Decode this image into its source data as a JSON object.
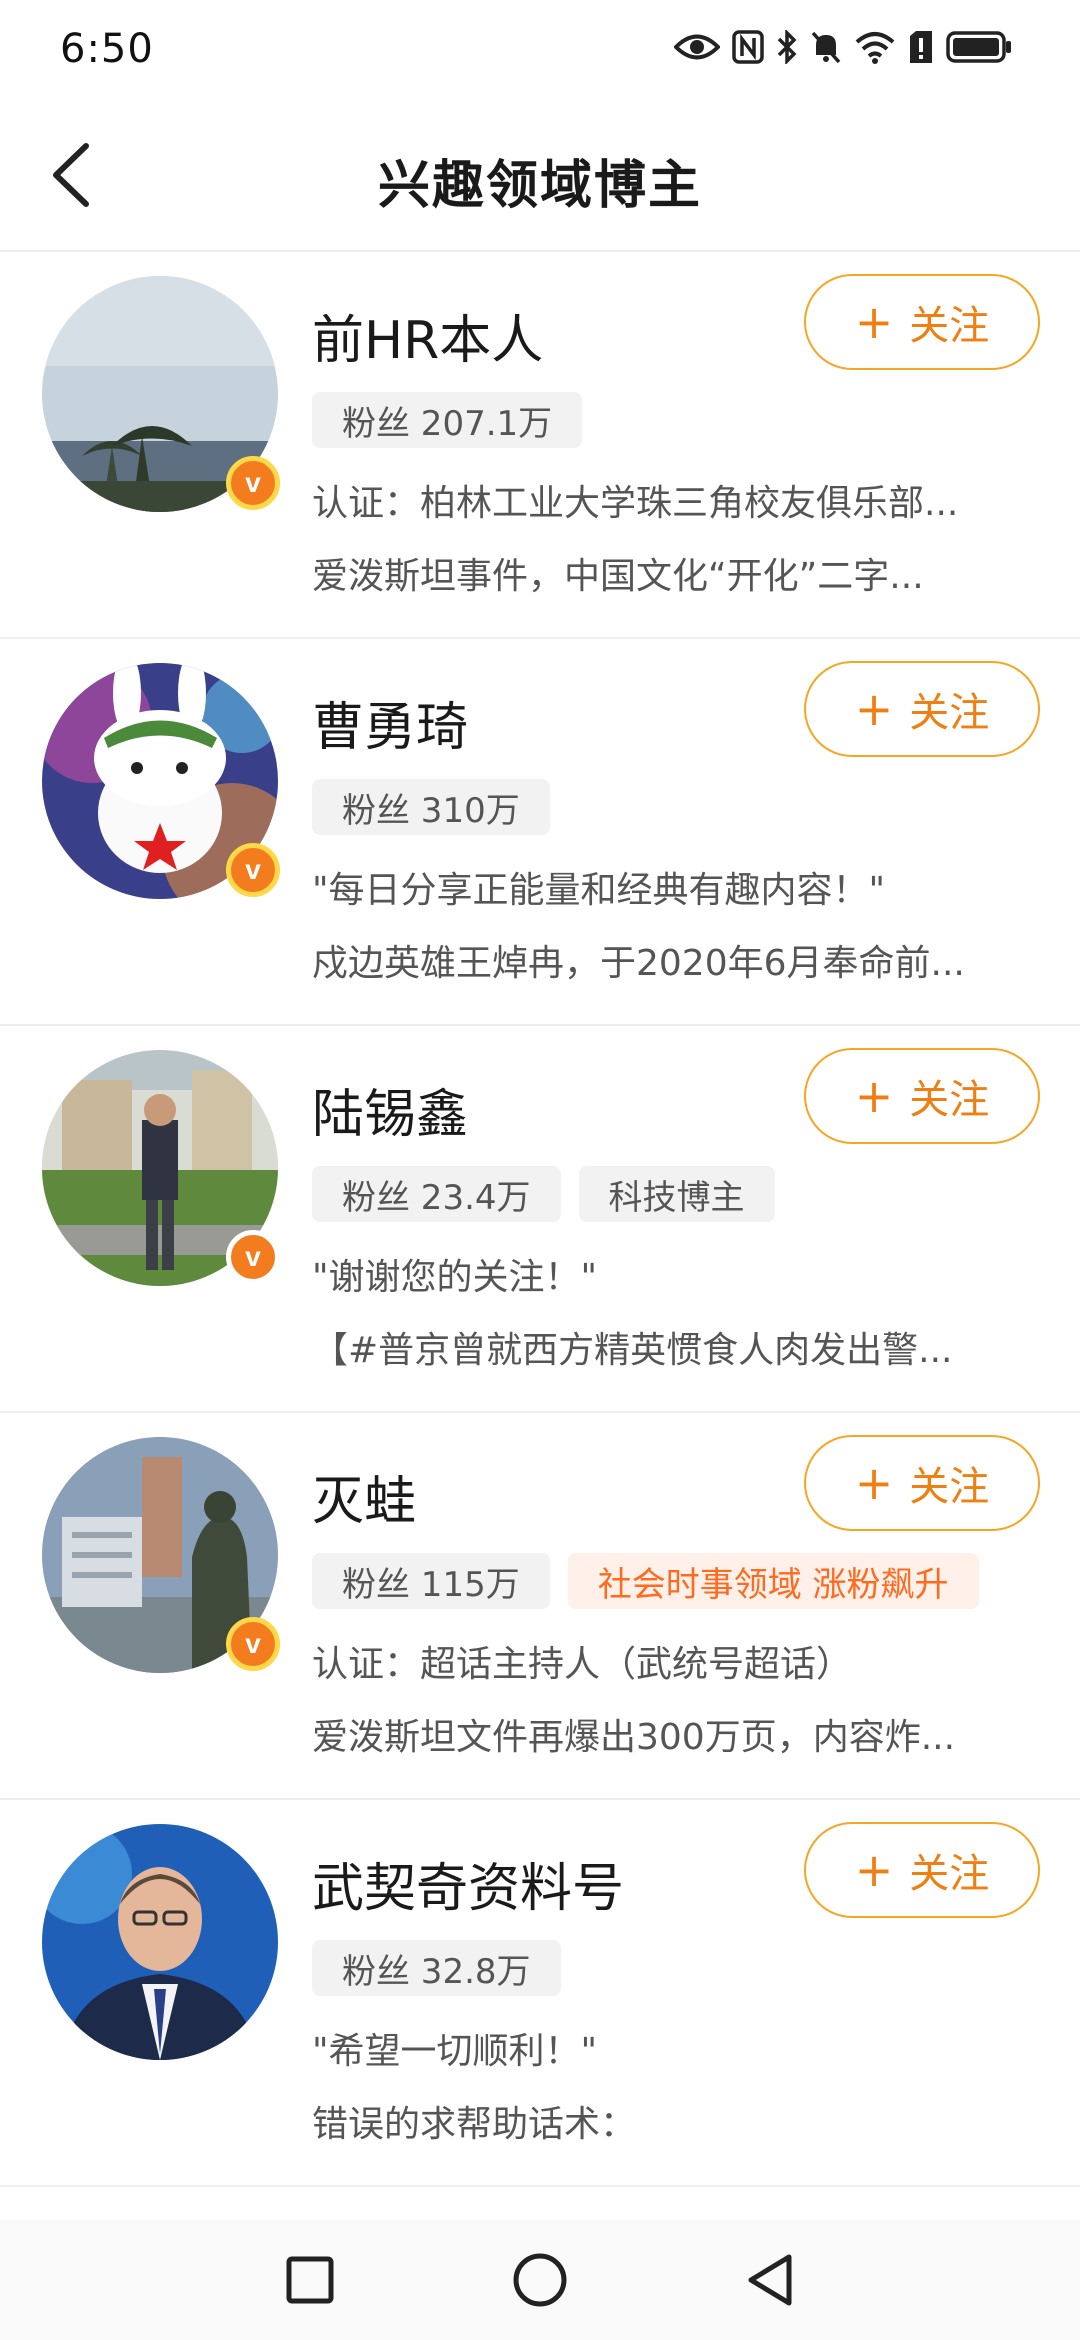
{
  "status_bar": {
    "time": "6:50"
  },
  "header": {
    "title": "兴趣领域博主"
  },
  "follow_label": "关注",
  "follow_plus": "+",
  "verified_mark": "v",
  "accent_color": "#f07f13",
  "bloggers": [
    {
      "name": "前HR本人",
      "tags": [
        "粉丝 207.1万"
      ],
      "desc1": "认证：柏林工业大学珠三角校友俱乐部...",
      "desc2": "爱泼斯坦事件，中国文化“开化”二字..."
    },
    {
      "name": "曹勇琦",
      "tags": [
        "粉丝 310万"
      ],
      "desc1": "\"每日分享正能量和经典有趣内容！\"",
      "desc2": "戍边英雄王焯冉，于2020年6月奉命前..."
    },
    {
      "name": "陆锡鑫",
      "tags": [
        "粉丝 23.4万",
        "科技博主"
      ],
      "desc1": "\"谢谢您的关注！\"",
      "desc2": "【#普京曾就西方精英惯食人肉发出警..."
    },
    {
      "name": "灭蛙",
      "tags": [
        "粉丝 115万"
      ],
      "hot_tag": "社会时事领域 涨粉飙升",
      "desc1": "认证：超话主持人（武统号超话）",
      "desc2": "爱泼斯坦文件再爆出300万页，内容炸..."
    },
    {
      "name": "武契奇资料号",
      "tags": [
        "粉丝 32.8万"
      ],
      "desc1": "\"希望一切顺利！\"",
      "desc2": "错误的求帮助话术："
    }
  ]
}
